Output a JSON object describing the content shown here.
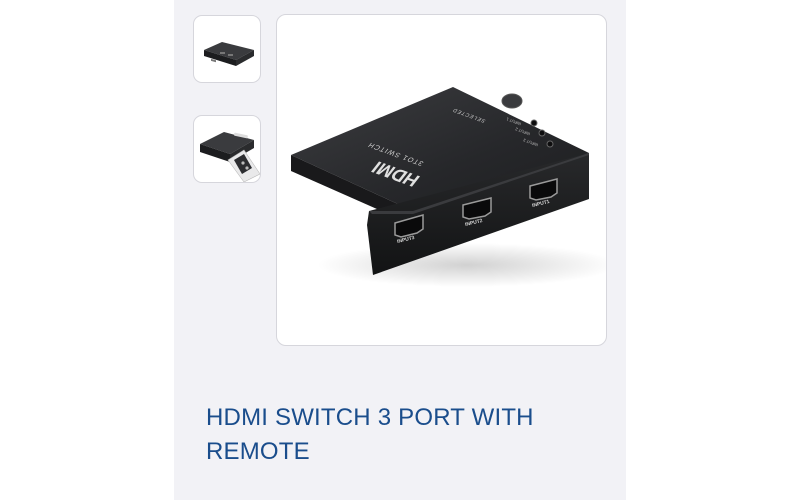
{
  "product": {
    "title": "HDMI SWITCH 3 PORT WITH REMOTE",
    "device_text": {
      "brand": "HDMI",
      "model": "3TO1 SWITCH",
      "port_labels": [
        "INPUT3",
        "INPUT2",
        "INPUT1"
      ],
      "led_labels": [
        "INPUT 1",
        "INPUT 2",
        "INPUT 3"
      ],
      "button_label": "SELECTED"
    }
  },
  "gallery": {
    "thumbnails": [
      {
        "icon": "hdmi-switch-thumbnail"
      },
      {
        "icon": "hdmi-switch-with-remote-thumbnail"
      }
    ],
    "main_image": {
      "icon": "hdmi-switch-photo"
    }
  },
  "colors": {
    "title": "#1a4d8c",
    "panel_background": "#f2f2f6",
    "device_body": "#1f2022"
  }
}
